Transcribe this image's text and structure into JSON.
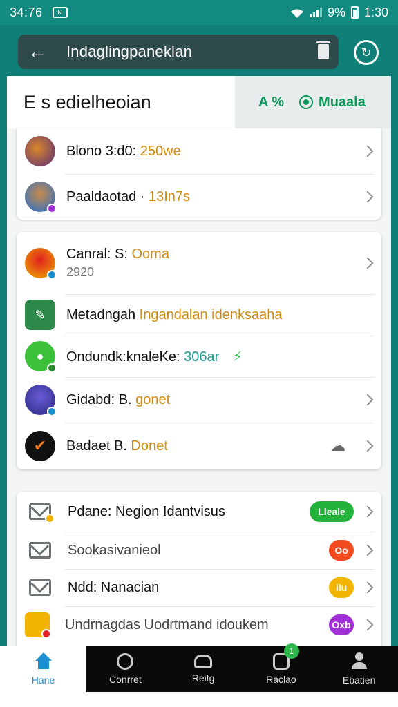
{
  "status_bar": {
    "time_left": "34:76",
    "battery": "9%",
    "time_right": "1:30"
  },
  "app_bar": {
    "title": "Indaglingpaneklan"
  },
  "header": {
    "title": "E s edielheoian",
    "action_a": "A %",
    "action_b": "Muaala"
  },
  "group1": [
    {
      "label": "Blono 3:d0:",
      "value": "250we"
    },
    {
      "label": "Paaldaotad ·",
      "value": "13In7s"
    }
  ],
  "group2": [
    {
      "label": "Canral: S:",
      "value": "Ooma",
      "sub": "2920"
    },
    {
      "label": "Metadngah",
      "value": "Ingandalan idenksaaha"
    },
    {
      "label": "Ondundk:knaleKe:",
      "value": "306ar"
    },
    {
      "label": "Gidabd: B.",
      "value": "gonet"
    },
    {
      "label": "Badaet B.",
      "value": "Donet"
    }
  ],
  "group3": [
    {
      "label": "Pdane: Negion Idantvisus",
      "badge": "Lleale",
      "badge_color": "#23b33a"
    },
    {
      "label": "Sookasivanieol",
      "badge": "Oo",
      "badge_color": "#f04a1e"
    },
    {
      "label": "Ndd: Nanacian",
      "badge": "ilu",
      "badge_color": "#f2b400"
    },
    {
      "label": "Undrnagdas Uodrtmand idoukem",
      "badge": "Oxb",
      "badge_color": "#a12fd6"
    }
  ],
  "bottom_nav": [
    {
      "label": "Hane",
      "active": true
    },
    {
      "label": "Conrret"
    },
    {
      "label": "Reitg"
    },
    {
      "label": "Raclao",
      "badge": "1"
    },
    {
      "label": "Ebatien"
    }
  ],
  "colors": {
    "primary": "#0f7f77",
    "accent_green": "#11975a",
    "accent_orange": "#d08a10",
    "nav_active": "#1a8fd0"
  }
}
